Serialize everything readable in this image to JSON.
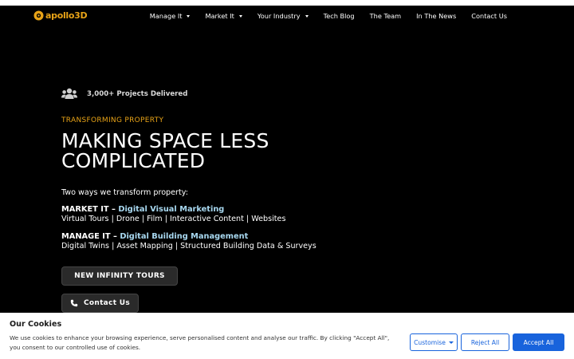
{
  "brand": {
    "logo_text": "apollo3D",
    "accent": "#e8a317"
  },
  "nav": {
    "items": [
      {
        "label": "Manage It",
        "dropdown": true
      },
      {
        "label": "Market It",
        "dropdown": true
      },
      {
        "label": "Your Industry",
        "dropdown": true
      },
      {
        "label": "Tech Blog",
        "dropdown": false
      },
      {
        "label": "The Team",
        "dropdown": false
      },
      {
        "label": "In The News",
        "dropdown": false
      },
      {
        "label": "Contact Us",
        "dropdown": false
      }
    ]
  },
  "hero": {
    "stat": "3,000+ Projects Delivered",
    "eyebrow": "TRANSFORMING PROPERTY",
    "headline_line1": "MAKING SPACE LESS",
    "headline_line2": "COMPLICATED",
    "intro": "Two ways we transform property:",
    "offers": [
      {
        "name": "MARKET IT – ",
        "link": "Digital Visual Marketing",
        "sub": "Virtual Tours | Drone | Film | Interactive Content | Websites"
      },
      {
        "name": "MANAGE IT – ",
        "link": "Digital Building Management",
        "sub": "Digital Twins | Asset Mapping | Structured Building Data & Surveys"
      }
    ],
    "tours_button": " NEW INFINITY TOURS ",
    "contact_button": "Contact Us"
  },
  "cookies": {
    "title": "Our Cookies",
    "text": "We use cookies to enhance your browsing experience, serve personalised content and analyse our traffic. By clicking \"Accept All\", you consent to our controlled use of cookies.",
    "customise": "Customise",
    "reject": "Reject All",
    "accept": "Accept All",
    "button_color": "#1863dc"
  }
}
